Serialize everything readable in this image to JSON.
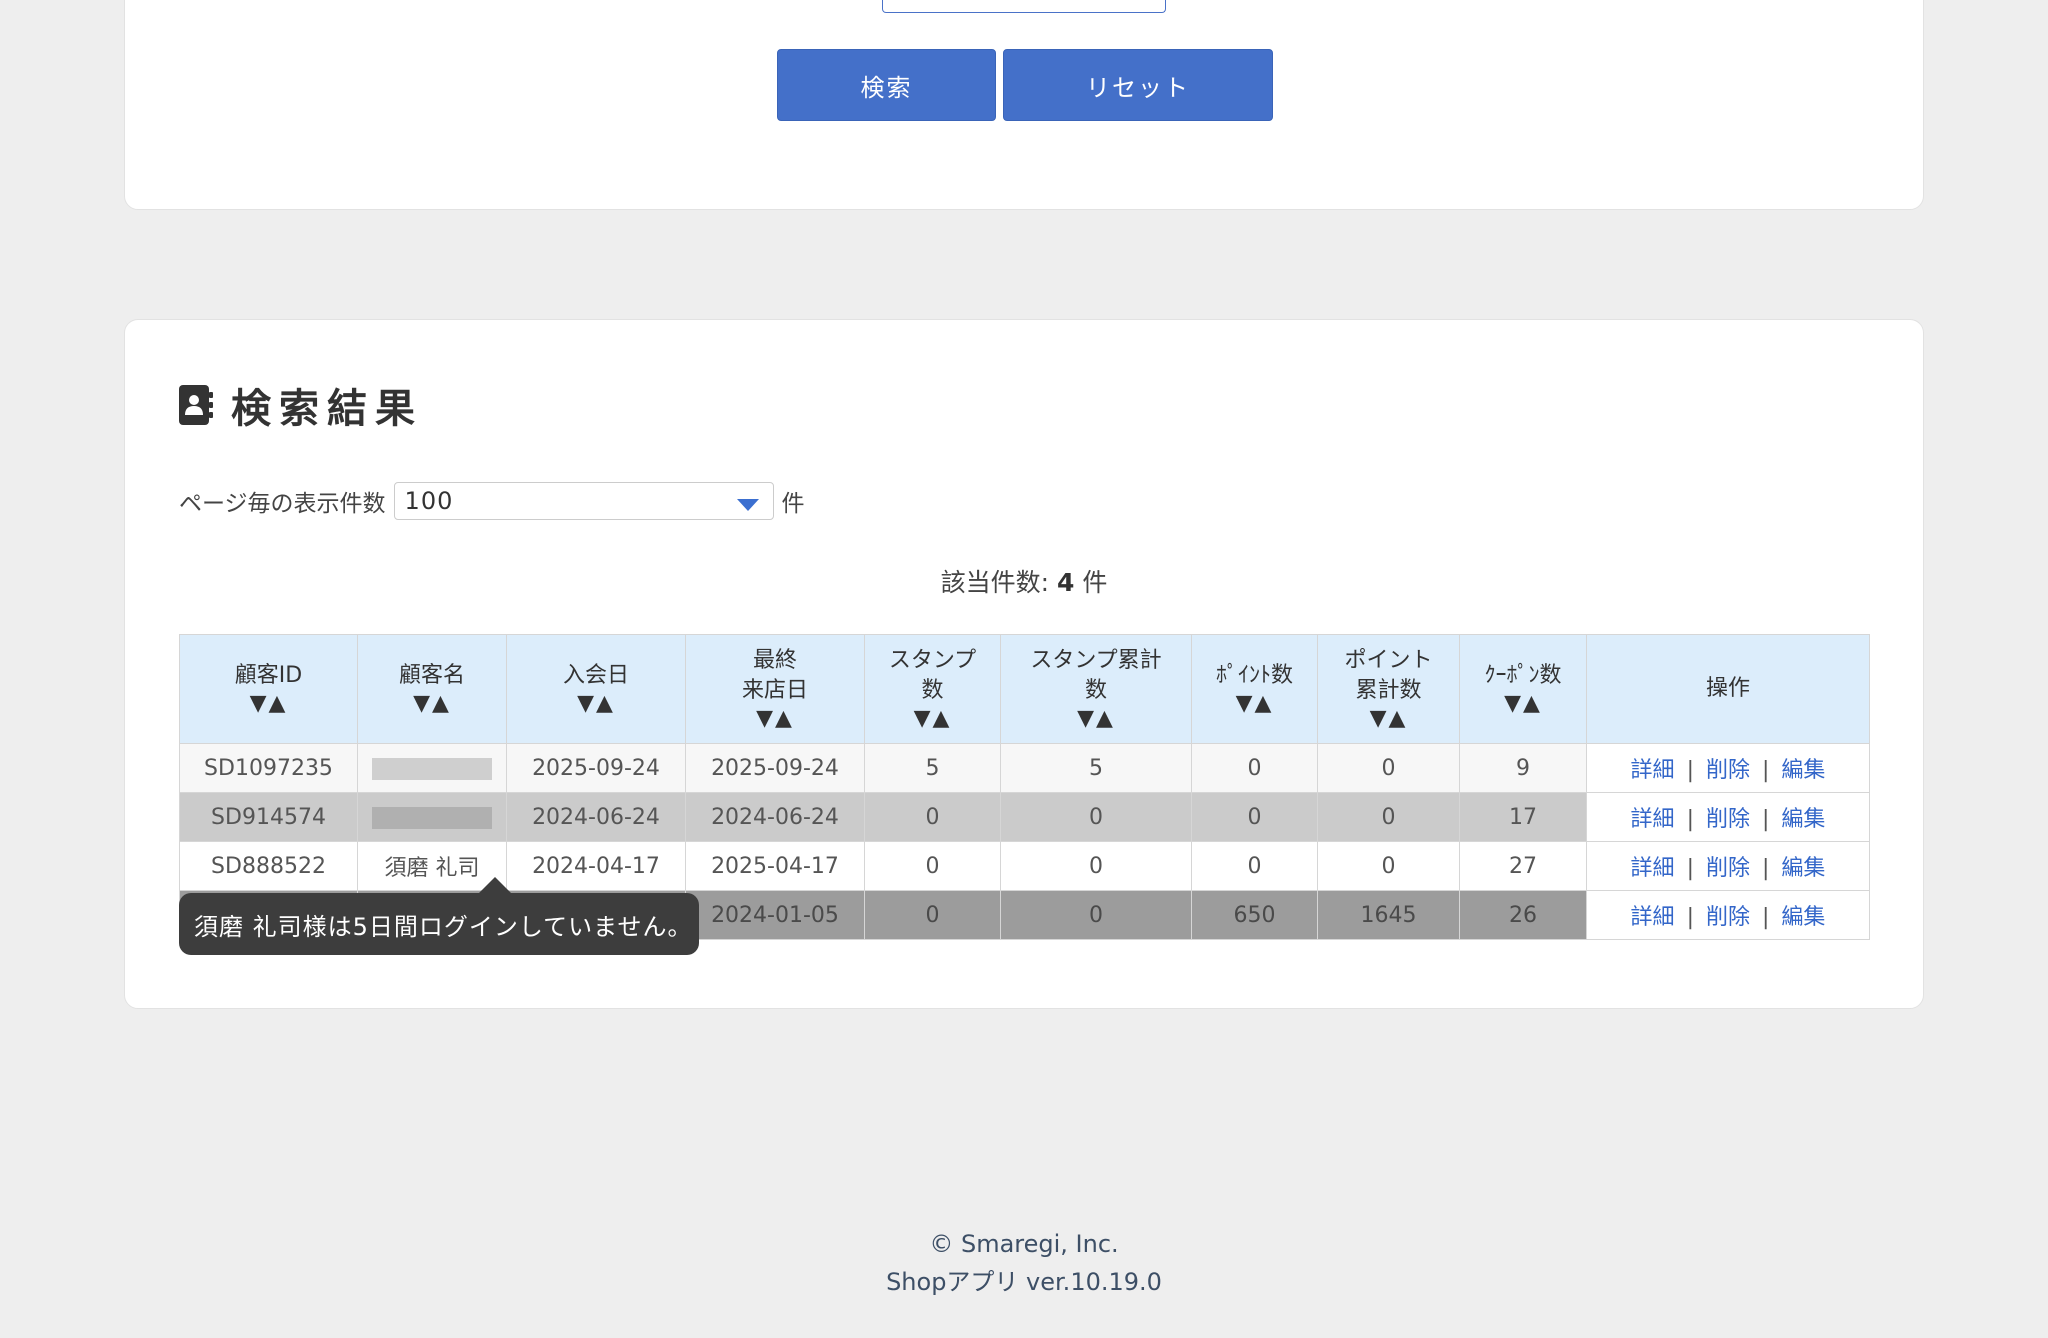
{
  "search_form": {
    "search_button": "検索",
    "reset_button": "リセット"
  },
  "results": {
    "title": "検索結果",
    "per_page_label": "ページ毎の表示件数",
    "per_page_value": "100",
    "per_page_unit": "件",
    "count_label": "該当件数:",
    "count_value": "4",
    "count_unit": "件",
    "columns": [
      {
        "line1": "顧客ID",
        "line2": ""
      },
      {
        "line1": "顧客名",
        "line2": ""
      },
      {
        "line1": "入会日",
        "line2": ""
      },
      {
        "line1": "最終",
        "line2": "来店日"
      },
      {
        "line1": "スタンプ",
        "line2": "数"
      },
      {
        "line1": "スタンプ累計",
        "line2": "数"
      },
      {
        "line1": "ﾎﾟｲﾝﾄ数",
        "line2": ""
      },
      {
        "line1": "ポイント",
        "line2": "累計数"
      },
      {
        "line1": "ｸｰﾎﾟﾝ数",
        "line2": ""
      },
      {
        "line1": "操作",
        "line2": ""
      }
    ],
    "sort_glyph": "▼▲",
    "rows": [
      {
        "id": "SD1097235",
        "name": "",
        "join_date": "2025-09-24",
        "last_visit": "2025-09-24",
        "stamps": "5",
        "stamps_total": "5",
        "points": "0",
        "points_total": "0",
        "coupons": "9"
      },
      {
        "id": "SD914574",
        "name": "",
        "join_date": "2024-06-24",
        "last_visit": "2024-06-24",
        "stamps": "0",
        "stamps_total": "0",
        "points": "0",
        "points_total": "0",
        "coupons": "17"
      },
      {
        "id": "SD888522",
        "name": "須磨 礼司",
        "join_date": "2024-04-17",
        "last_visit": "2025-04-17",
        "stamps": "0",
        "stamps_total": "0",
        "points": "0",
        "points_total": "0",
        "coupons": "27"
      },
      {
        "id": "",
        "name": "",
        "join_date": "",
        "last_visit": "2024-01-05",
        "stamps": "0",
        "stamps_total": "0",
        "points": "650",
        "points_total": "1645",
        "coupons": "26"
      }
    ],
    "actions": {
      "detail": "詳細",
      "delete": "削除",
      "edit": "編集",
      "separator": "|"
    }
  },
  "tooltip": {
    "text": "須磨 礼司様は5日間ログインしていません。"
  },
  "footer": {
    "copyright": "© Smaregi, Inc.",
    "version": "Shopアプリ ver.10.19.0"
  },
  "colors": {
    "accent": "#4470c9",
    "link": "#3366c9",
    "header_bg": "#dcedfb",
    "tooltip_bg": "#3d3d3d"
  }
}
